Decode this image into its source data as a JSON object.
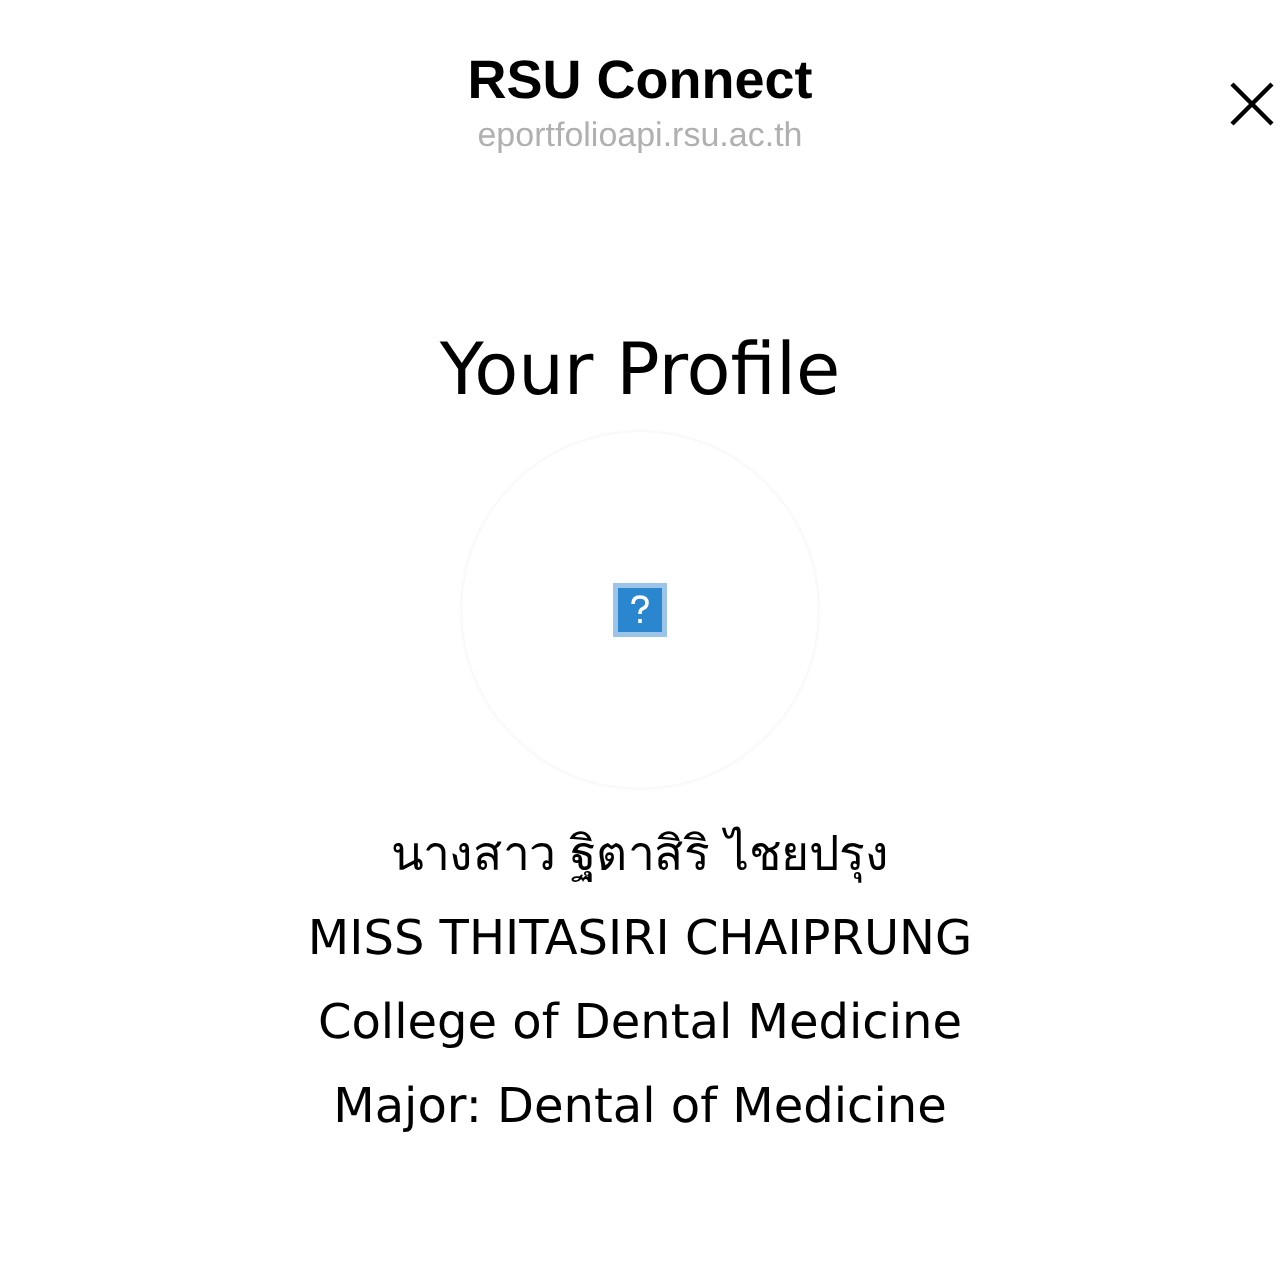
{
  "header": {
    "title": "RSU Connect",
    "url": "eportfolioapi.rsu.ac.th"
  },
  "page_title": "Your Profile",
  "profile": {
    "photo": {
      "kind": "broken_image"
    },
    "lines": [
      "นางสาว ฐิตาสิริ ไชยปรุง",
      "MISS THITASIRI CHAIPRUNG",
      "College of Dental Medicine",
      "Major: Dental of Medicine"
    ]
  }
}
